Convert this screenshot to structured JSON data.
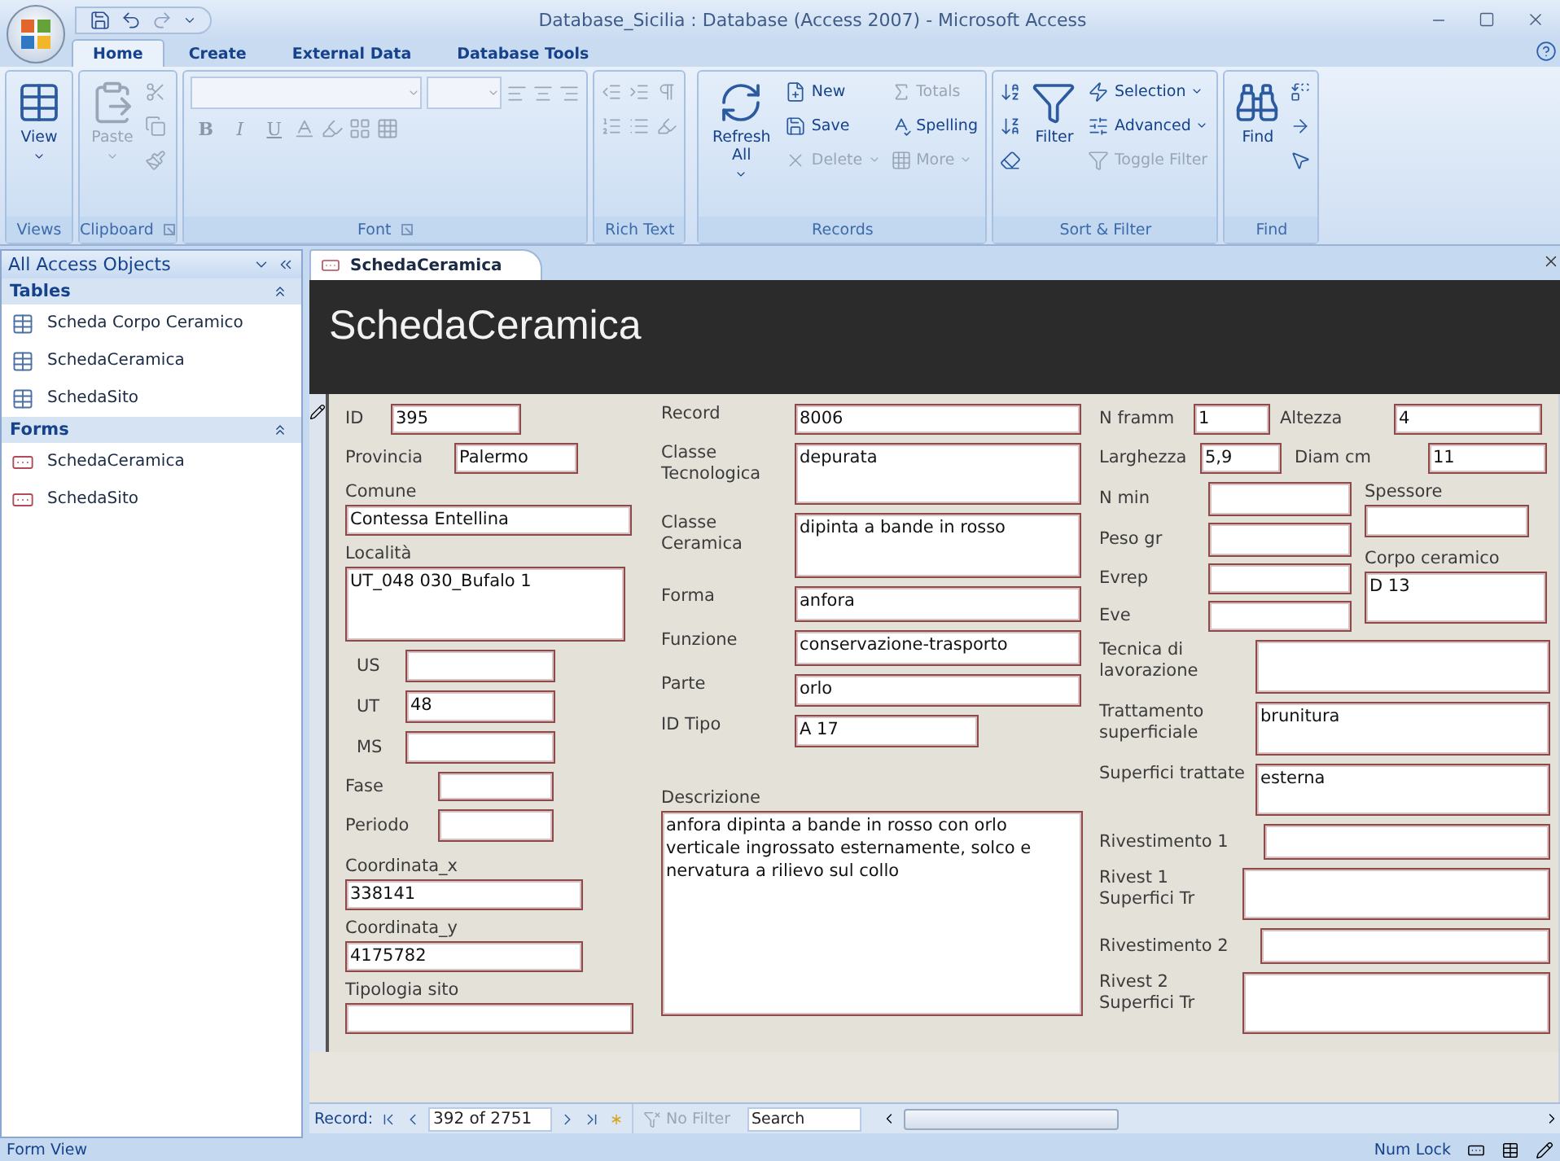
{
  "window": {
    "title": "Database_Sicilia : Database (Access 2007) - Microsoft Access"
  },
  "ribbon_tabs": [
    {
      "label": "Home",
      "selected": true
    },
    {
      "label": "Create",
      "selected": false
    },
    {
      "label": "External Data",
      "selected": false
    },
    {
      "label": "Database Tools",
      "selected": false
    }
  ],
  "ribbon": {
    "groups": [
      {
        "label": "Views",
        "buttons": [
          {
            "label": "View",
            "kind": "large",
            "disabled": false
          }
        ]
      },
      {
        "label": "Clipboard",
        "buttons": [
          {
            "label": "Paste",
            "kind": "large",
            "disabled": true
          }
        ]
      },
      {
        "label": "Font",
        "buttons": [
          {
            "label": "B",
            "kind": "glyph",
            "disabled": true
          },
          {
            "label": "I",
            "kind": "glyph",
            "disabled": true
          },
          {
            "label": "U",
            "kind": "glyph",
            "disabled": true
          }
        ]
      },
      {
        "label": "Rich Text"
      },
      {
        "label": "Records",
        "buttons": [
          {
            "label": "Refresh All",
            "kind": "large",
            "disabled": false
          },
          {
            "label": "New",
            "kind": "small",
            "disabled": false
          },
          {
            "label": "Save",
            "kind": "small",
            "disabled": false
          },
          {
            "label": "Delete",
            "kind": "small",
            "disabled": true
          },
          {
            "label": "Totals",
            "kind": "small",
            "disabled": true
          },
          {
            "label": "Spelling",
            "kind": "small",
            "disabled": false
          },
          {
            "label": "More",
            "kind": "small",
            "disabled": true
          }
        ]
      },
      {
        "label": "Sort & Filter",
        "buttons": [
          {
            "label": "Filter",
            "kind": "large",
            "disabled": false
          },
          {
            "label": "Selection",
            "kind": "small",
            "disabled": false
          },
          {
            "label": "Advanced",
            "kind": "small",
            "disabled": false
          },
          {
            "label": "Toggle Filter",
            "kind": "small",
            "disabled": true
          }
        ]
      },
      {
        "label": "Find",
        "buttons": [
          {
            "label": "Find",
            "kind": "large",
            "disabled": false
          }
        ]
      }
    ]
  },
  "navigation_pane": {
    "title": "All Access Objects",
    "sections": [
      {
        "label": "Tables",
        "kind": "table",
        "expanded": true,
        "items": [
          "Scheda Corpo Ceramico",
          "SchedaCeramica",
          "SchedaSito"
        ]
      },
      {
        "label": "Forms",
        "kind": "form",
        "expanded": true,
        "items": [
          "SchedaCeramica",
          "SchedaSito"
        ]
      }
    ]
  },
  "document_tabs": [
    {
      "label": "SchedaCeramica",
      "selected": true
    }
  ],
  "form": {
    "title": "SchedaCeramica",
    "column_1": [
      {
        "label": "ID",
        "kind": "inline",
        "value": "395"
      },
      {
        "label": "Provincia",
        "kind": "inline",
        "value": "Palermo"
      },
      {
        "label": "Comune",
        "kind": "stacked",
        "value": "Contessa Entellina"
      },
      {
        "label": "Località",
        "kind": "stacked",
        "value": "UT_048 030_Bufalo 1"
      },
      {
        "label": "US",
        "kind": "inline"
      },
      {
        "label": "UT",
        "kind": "inline",
        "value": "48"
      },
      {
        "label": "MS",
        "kind": "inline"
      },
      {
        "label": "Fase",
        "kind": "inline"
      },
      {
        "label": "Periodo",
        "kind": "inline"
      },
      {
        "label": "Coordinata_x",
        "kind": "stacked",
        "value": "338141"
      },
      {
        "label": "Coordinata_y",
        "kind": "stacked",
        "value": "4175782"
      },
      {
        "label": "Tipologia sito",
        "kind": "stacked"
      }
    ],
    "column_2": [
      {
        "label": "Record",
        "kind": "inline",
        "value": "8006"
      },
      {
        "label": "Classe Tecnologica",
        "kind": "inline",
        "value": "depurata"
      },
      {
        "label": "Classe Ceramica",
        "kind": "inline",
        "value": "dipinta a bande in rosso"
      },
      {
        "label": "Forma",
        "kind": "inline",
        "value": "anfora"
      },
      {
        "label": "Funzione",
        "kind": "inline",
        "value": "conservazione-trasporto"
      },
      {
        "label": "Parte",
        "kind": "inline",
        "value": "orlo"
      },
      {
        "label": "ID Tipo",
        "kind": "inline",
        "value": "A 17"
      },
      {
        "label": "Descrizione",
        "kind": "stacked",
        "value": "anfora dipinta a bande in rosso con orlo verticale ingrossato esternamente, solco e nervatura a rilievo sul collo"
      }
    ],
    "measures_top": [
      {
        "label": "N framm",
        "kind": "inline",
        "value": "1"
      },
      {
        "label": "Altezza",
        "kind": "inline",
        "value": "4"
      },
      {
        "label": "Larghezza",
        "kind": "inline",
        "value": "5,9"
      },
      {
        "label": "Diam cm",
        "kind": "inline",
        "value": "11"
      }
    ],
    "measures_left": [
      {
        "label": "N min",
        "kind": "inline"
      },
      {
        "label": "Peso gr",
        "kind": "inline"
      },
      {
        "label": "Evrep",
        "kind": "inline"
      },
      {
        "label": "Eve",
        "kind": "inline"
      }
    ],
    "measures_right": [
      {
        "label": "Spessore",
        "kind": "stacked"
      },
      {
        "label": "Corpo ceramico",
        "kind": "stacked",
        "value": "D 13"
      }
    ],
    "finish_fields": [
      {
        "label": "Tecnica di lavorazione",
        "kind": "inline"
      },
      {
        "label": "Trattamento superficiale",
        "kind": "inline",
        "value": "brunitura"
      },
      {
        "label": "Superfici trattate",
        "kind": "inline",
        "value": "esterna"
      },
      {
        "label": "Rivestimento 1",
        "kind": "inline"
      },
      {
        "label": "Rivest 1 Superfici Tr",
        "kind": "inline"
      },
      {
        "label": "Rivestimento 2",
        "kind": "inline"
      },
      {
        "label": "Rivest 2 Superfici Tr",
        "kind": "inline"
      }
    ]
  },
  "record_navigator": {
    "label": "Record:",
    "position": "392 of 2751",
    "filter": "No Filter",
    "search": {
      "placeholder": "Search"
    }
  },
  "status_bar": {
    "mode": "Form View",
    "indicator": "Num Lock"
  }
}
